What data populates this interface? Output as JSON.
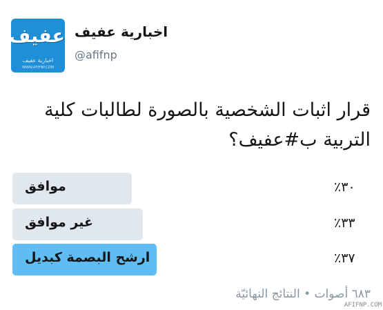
{
  "account": {
    "display_name": "اخبارية عفيف",
    "handle": "@afifnp",
    "avatar": {
      "logo_text": "عفيف",
      "caption": "اخبارية عفيف",
      "url": "WWW.AFIFNP.COM",
      "background": "#1f8fd8"
    }
  },
  "tweet": {
    "text": "قرار اثبات الشخصية بالصورة لطالبات كلية التربية ب#عفيف؟"
  },
  "poll": {
    "options": [
      {
        "label": "موافق",
        "percent_text": "٣٠٪",
        "percent": 30,
        "winner": false
      },
      {
        "label": "غير موافق",
        "percent_text": "٣٣٪",
        "percent": 33,
        "winner": false
      },
      {
        "label": "ارشح البصمة كبديل",
        "percent_text": "٣٧٪",
        "percent": 37,
        "winner": true
      }
    ],
    "summary": "٦٨٣ أصوات • النتائج النهائيّة",
    "bar_color": "#e1e8ed",
    "winner_color": "#5fbdf3"
  },
  "watermark": "AFIFNP.COM"
}
